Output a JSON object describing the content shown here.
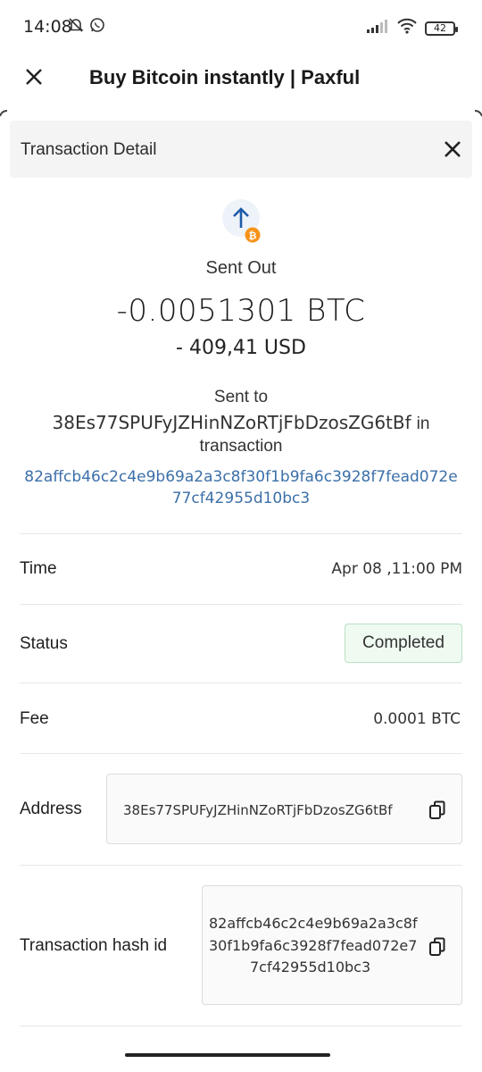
{
  "status_bar": {
    "time": "14:08",
    "battery": "42",
    "icons": [
      "mute-bell-icon",
      "whatsapp-icon",
      "signal-icon",
      "wifi-icon",
      "battery-icon"
    ]
  },
  "app_bar": {
    "title": "Buy Bitcoin instantly | Paxful",
    "close_icon": "close-icon"
  },
  "panel": {
    "title": "Transaction Detail",
    "close_icon": "close-icon"
  },
  "summary": {
    "icon": "arrow-up-bitcoin-icon",
    "kind": "Sent Out",
    "amount": "-0.0051301 BTC",
    "fiat": "- 409,41 USD",
    "sent_to_label": "Sent to",
    "address": "38Es77SPUFyJZHinNZoRTjFbDzosZG6tBf",
    "in_label": "in",
    "transaction_label": "transaction",
    "hash_line1": "82affcb46c2c4e9b69a2a3c8f30f1b9fa6c3928f7fead072e",
    "hash_line2": "77cf42955d10bc3"
  },
  "details": {
    "time_label": "Time",
    "time_value": "Apr 08 ,11:00 PM",
    "status_label": "Status",
    "status_value": "Completed",
    "fee_label": "Fee",
    "fee_value": "0.0001 BTC",
    "address_label": "Address",
    "address_value": "38Es77SPUFyJZHinNZoRTjFbDzosZG6tBf",
    "hash_label": "Transaction hash id",
    "hash_line1": "82affcb46c2c4e9b69a2a3c8f",
    "hash_line2": "30f1b9fa6c3928f7fead072e7",
    "hash_line3": "7cf42955d10bc3"
  },
  "colors": {
    "link": "#3b6fa8",
    "status_bg": "#effaf1",
    "status_border": "#b9e1c2",
    "bitcoin": "#f7931a",
    "arrow": "#1e5aa8"
  }
}
